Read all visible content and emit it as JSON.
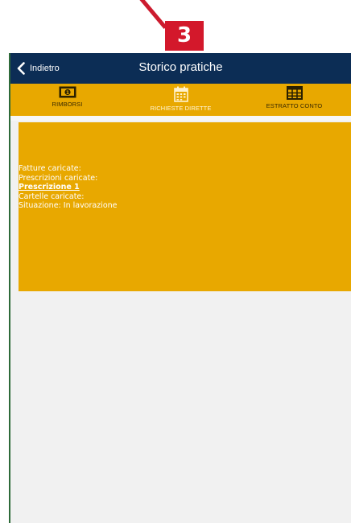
{
  "callout": {
    "number": "3"
  },
  "header": {
    "back_label": "Indietro",
    "title": "Storico pratiche"
  },
  "tabs": [
    {
      "label": "RIMBORSI",
      "icon": "banknote-icon",
      "active": false
    },
    {
      "label": "RICHIESTE DIRETTE",
      "icon": "calendar-icon",
      "active": true
    },
    {
      "label": "ESTRATTO CONTO",
      "icon": "table-icon",
      "active": false
    }
  ],
  "card": {
    "fatture": "Fatture caricate:",
    "prescrizioni": "Prescrizioni caricate:",
    "prescrizione_link": "Prescrizione 1",
    "cartelle": "Cartelle caricate:",
    "situazione": "Situazione: In lavorazione"
  },
  "colors": {
    "header_bg": "#0c2d55",
    "accent": "#e8a800",
    "callout": "#d3182b"
  }
}
